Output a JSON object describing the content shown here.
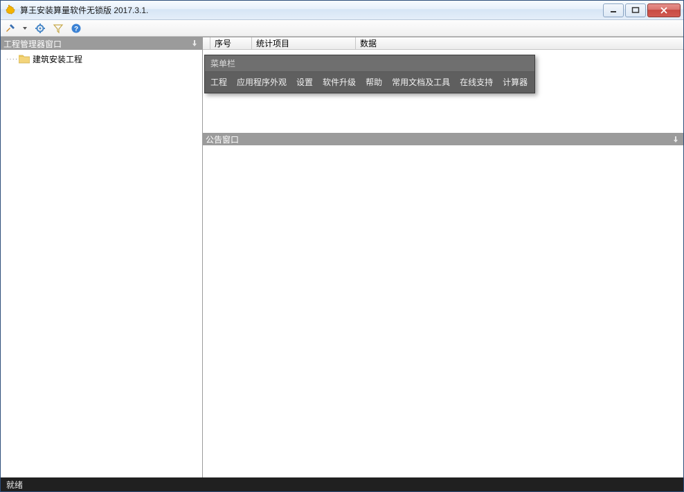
{
  "window": {
    "title": "算王安装算量软件无锁版 2017.3.1."
  },
  "toolbar": {
    "icons": [
      "tools-icon",
      "gear-icon",
      "filter-icon",
      "help-icon"
    ]
  },
  "sidebar": {
    "title": "工程管理器窗口",
    "tree_root": "建筑安装工程"
  },
  "table": {
    "columns": [
      "序号",
      "统计项目",
      "数据"
    ]
  },
  "menubar_popup": {
    "title": "菜单栏",
    "items": [
      "工程",
      "应用程序外观",
      "设置",
      "软件升级",
      "帮助",
      "常用文档及工具",
      "在线支持",
      "计算器"
    ]
  },
  "announce": {
    "title": "公告窗口"
  },
  "statusbar": {
    "text": "就绪"
  }
}
